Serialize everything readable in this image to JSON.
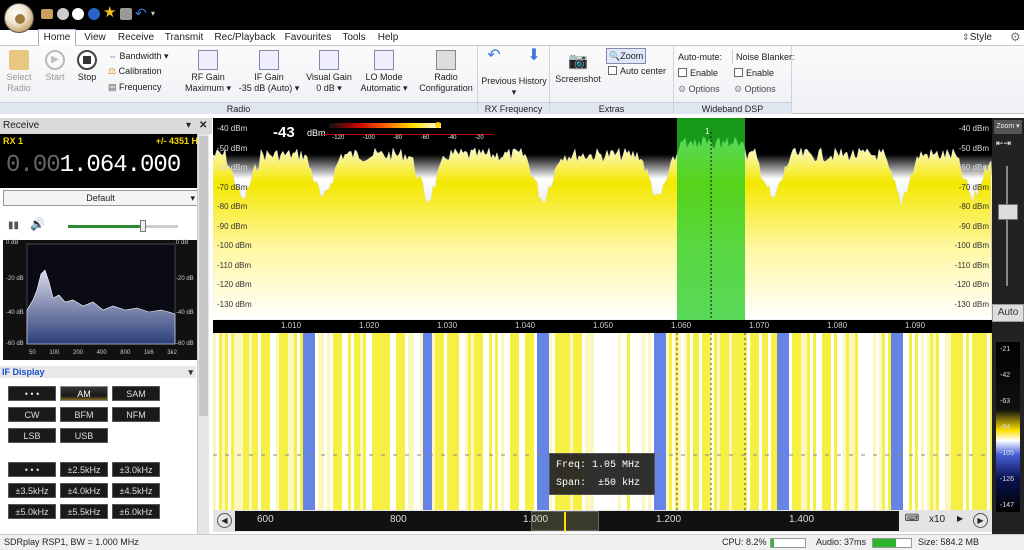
{
  "title_bar": {
    "quick_access_icons": [
      "folder-icon",
      "play-icon",
      "stop-icon",
      "add-icon",
      "star-icon",
      "camera-icon",
      "undo-icon",
      "dropdown-icon"
    ]
  },
  "tabs": [
    {
      "label": "Home",
      "active": true
    },
    {
      "label": "View"
    },
    {
      "label": "Receive"
    },
    {
      "label": "Transmit"
    },
    {
      "label": "Rec/Playback"
    },
    {
      "label": "Favourites"
    },
    {
      "label": "Tools"
    },
    {
      "label": "Help"
    }
  ],
  "style_label": "Style",
  "ribbon": {
    "radio_group_label": "Radio",
    "select_radio": "Select Radio",
    "start": "Start",
    "stop": "Stop",
    "bandwidth": "Bandwidth",
    "calibration": "Calibration",
    "frequency": "Frequency",
    "rf_gain": "RF Gain",
    "rf_gain_value": "Maximum",
    "if_gain": "IF Gain",
    "if_gain_value": "-35 dB (Auto)",
    "visual_gain": "Visual Gain",
    "visual_gain_value": "0 dB",
    "lo_mode": "LO Mode",
    "lo_mode_value": "Automatic",
    "radio_config": "Radio Configuration",
    "rx_frequency_group": "RX Frequency",
    "previous_history": "Previous History",
    "extras_group": "Extras",
    "screenshot": "Screenshot",
    "zoom": "Zoom",
    "auto_center": "Auto center",
    "wideband_dsp_group": "Wideband DSP",
    "auto_mute": "Auto-mute:",
    "noise_blanker": "Noise Blanker:",
    "enable": "Enable",
    "options": "Options"
  },
  "receive_panel": {
    "header": "Receive",
    "rx_label": "RX 1",
    "offset": "+/- 4351 H",
    "frequency_dim": "0.00",
    "frequency": "1.064.000",
    "preset": "Default",
    "mini_spectrum_labels": {
      "left_db": [
        "0 dB",
        "-20 dB",
        "-40 dB",
        "-60 dB"
      ],
      "right_db": [
        "0 dB",
        "-20 dB",
        "-40 dB",
        "-60 dB"
      ],
      "hz": [
        "50",
        "100",
        "200",
        "400",
        "800",
        "1k6",
        "3k2"
      ]
    },
    "if_display": "IF Display",
    "modes": [
      "• • •",
      "AM",
      "SAM",
      "CW",
      "BFM",
      "NFM",
      "LSB",
      "USB"
    ],
    "selected_mode": "AM",
    "bandwidths": [
      "• • •",
      "±2.5kHz",
      "±3.0kHz",
      "±3.5kHz",
      "±4.0kHz",
      "±4.5kHz",
      "±5.0kHz",
      "±5.5kHz",
      "±6.0kHz"
    ]
  },
  "spectrum": {
    "level_readout": "-43",
    "level_unit": "dBm",
    "meter_scale": [
      "-120",
      "-100",
      "-80",
      "-60",
      "-40",
      "-20"
    ],
    "db_labels_left": [
      "-40 dBm",
      "-50 dBm",
      "-60 dBm",
      "-70 dBm",
      "-80 dBm",
      "-90 dBm",
      "-100 dBm",
      "-110 dBm",
      "-120 dBm",
      "-130 dBm"
    ],
    "db_labels_right": [
      "-40 dBm",
      "-50 dBm",
      "-60 dBm",
      "-70 dBm",
      "-80 dBm",
      "-90 dBm",
      "-100 dBm",
      "-110 dBm",
      "-120 dBm",
      "-130 dBm"
    ],
    "freq_ticks": [
      "1.010",
      "1.020",
      "1.030",
      "1.040",
      "1.050",
      "1.060",
      "1.070",
      "1.080",
      "1.090"
    ],
    "receiver_marker": "1"
  },
  "tooltip": {
    "freq_label": "Freq:",
    "freq_value": "1.05 MHz",
    "span_label": "Span:",
    "span_value": "±50 kHz"
  },
  "bottom_nav": {
    "ticks": [
      "600",
      "800",
      "1.000",
      "1.200",
      "1.400"
    ],
    "zoom_factor": "x10"
  },
  "right_panel": {
    "zoom_label": "Zoom",
    "auto_label": "Auto",
    "scale": [
      "-21",
      "-42",
      "-63",
      "-84",
      "-105",
      "-126",
      "-147"
    ]
  },
  "status": {
    "device": "SDRplay RSP1, BW = 1.000 MHz",
    "cpu_label": "CPU:",
    "cpu_value": "8.2%",
    "cpu_level": 0.08,
    "audio_label": "Audio:",
    "audio_value": "37ms",
    "audio_level": 0.6,
    "size_label": "Size:",
    "size_value": "584.2 MB"
  },
  "colors": {
    "accent_blue": "#1a4fd0",
    "receiver_green": "#22cc22",
    "signal_yellow": "#f0e000",
    "waterfall_blue": "#3a5fd0"
  }
}
